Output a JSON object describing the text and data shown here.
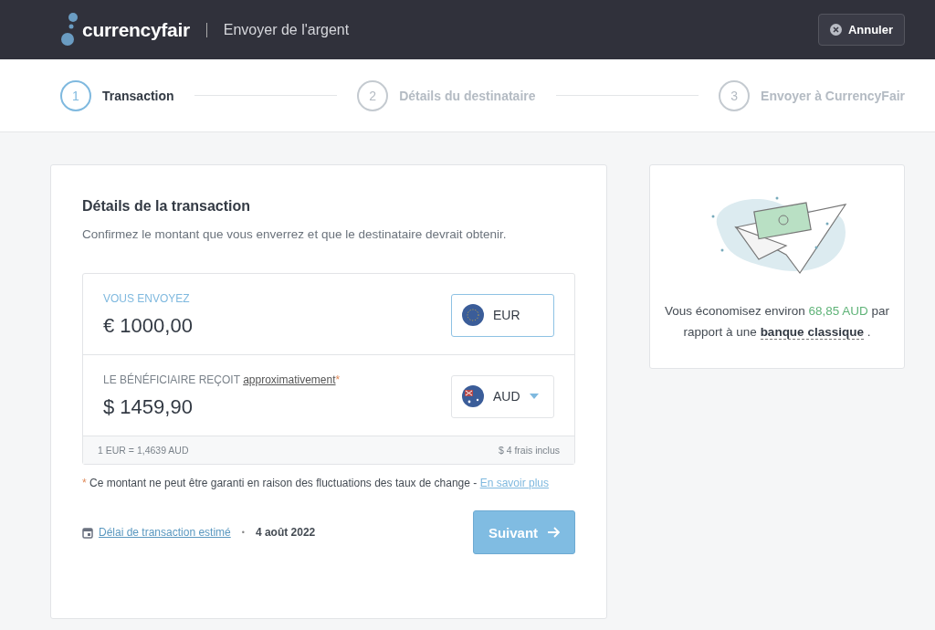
{
  "header": {
    "brand": "currencyfair",
    "title": "Envoyer de l'argent",
    "cancel": "Annuler"
  },
  "steps": [
    {
      "number": "1",
      "label": "Transaction",
      "selected": true
    },
    {
      "number": "2",
      "label": "Détails du destinataire",
      "selected": false
    },
    {
      "number": "3",
      "label": "Envoyer à CurrencyFair",
      "selected": false
    }
  ],
  "transaction": {
    "title": "Détails de la transaction",
    "subtitle": "Confirmez le montant que vous enverrez et que le destinataire devrait obtenir.",
    "send": {
      "label": "VOUS ENVOYEZ",
      "amount": "€ 1000,00",
      "currency": "EUR",
      "focused": true
    },
    "receive": {
      "label": "LE BÉNÉFICIAIRE REÇOIT",
      "label_link": "approximativement",
      "mark": "*",
      "amount": "$ 1459,90",
      "currency": "AUD"
    },
    "rate": "1 EUR = 1,4639 AUD",
    "fees": "$ 4 frais inclus",
    "note": {
      "mark": "*",
      "text": "Ce montant ne peut être garanti en raison des fluctuations des taux de change - ",
      "link": "En savoir plus"
    },
    "delay_link": "Délai de transaction estimé",
    "separator": "•",
    "date": "4 août 2022",
    "next": "Suivant"
  },
  "savings": {
    "before": "Vous économisez environ ",
    "amount": "68,85 AUD",
    "middle": " par rapport à une ",
    "link": "banque classique",
    "after": " ."
  }
}
